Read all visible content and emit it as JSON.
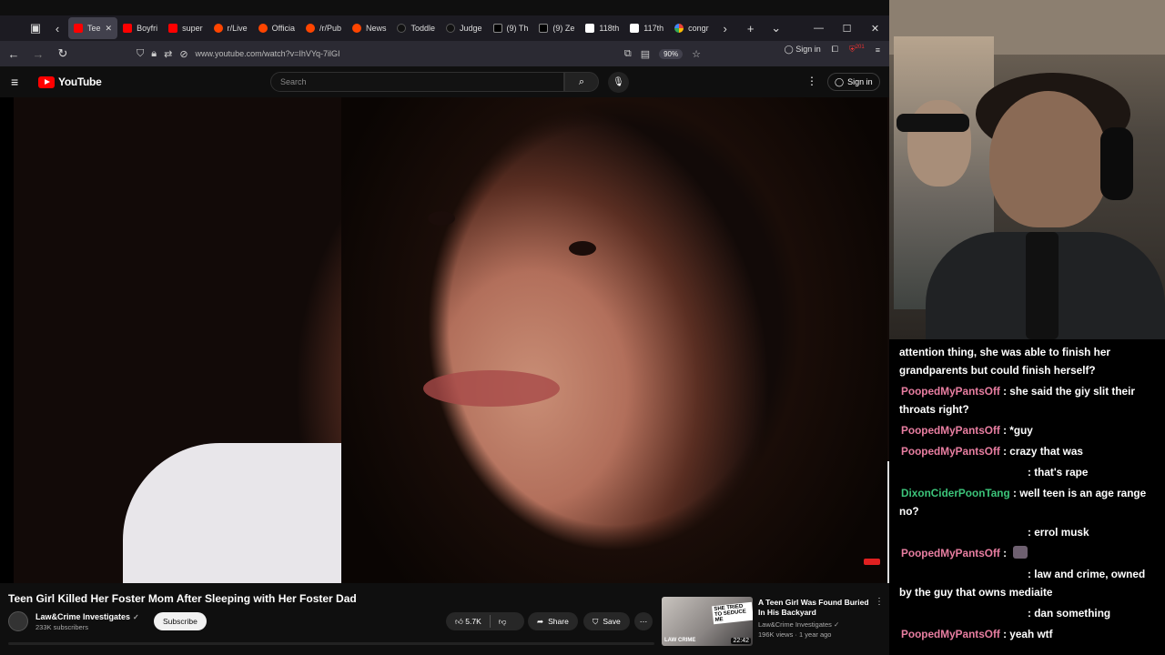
{
  "browser": {
    "tabs": [
      {
        "label": "Tee",
        "icon": "youtube-favicon",
        "active": true
      },
      {
        "label": "Boyfri",
        "icon": "youtube-favicon"
      },
      {
        "label": "super",
        "icon": "youtube-favicon"
      },
      {
        "label": "r/Live",
        "icon": "reddit-favicon"
      },
      {
        "label": "Officia",
        "icon": "reddit-favicon"
      },
      {
        "label": "/r/Pub",
        "icon": "reddit-favicon"
      },
      {
        "label": "News",
        "icon": "reddit-favicon"
      },
      {
        "label": "Toddle",
        "icon": "tiktok-favicon"
      },
      {
        "label": "Judge",
        "icon": "site-favicon"
      },
      {
        "label": "(9) Th",
        "icon": "x-favicon"
      },
      {
        "label": "(9) Ze",
        "icon": "x-favicon"
      },
      {
        "label": "118th",
        "icon": "wikipedia-favicon"
      },
      {
        "label": "117th",
        "icon": "wikipedia-favicon"
      },
      {
        "label": "congr",
        "icon": "google-favicon"
      }
    ],
    "url": "www.youtube.com/watch?v=IhVYq-7ilGI",
    "zoom": "90%",
    "signin_label": "Sign in",
    "notification_count": "201"
  },
  "youtube": {
    "logo_text": "YouTube",
    "search_placeholder": "Search",
    "signin_label": "Sign in",
    "video": {
      "title": "Teen Girl Killed Her Foster Mom After Sleeping with Her Foster Dad",
      "channel": "Law&Crime Investigates",
      "subscribers": "233K subscribers",
      "subscribe_label": "Subscribe",
      "likes": "5.7K",
      "share_label": "Share",
      "save_label": "Save"
    },
    "recommended": {
      "title": "A Teen Girl Was Found Buried In His Backyard",
      "channel": "Law&Crime Investigates",
      "meta": "196K views · 1 year ago",
      "duration": "22:42",
      "thumb_caption": "SHE TRIED TO SEDUCE ME",
      "thumb_logo": "LAW CRIME"
    }
  },
  "chat": {
    "colors": {
      "pink": "#e87ea1",
      "green": "#3cc47a"
    },
    "messages": [
      {
        "user": "",
        "text": "attention thing, she was able to finish her grandparents but could finish herself?"
      },
      {
        "user": "PoopedMyPantsOff",
        "color": "pink",
        "text": "she said the giy slit their throats right?"
      },
      {
        "user": "PoopedMyPantsOff",
        "color": "pink",
        "text": "*guy"
      },
      {
        "user": "PoopedMyPantsOff",
        "color": "pink",
        "text": "crazy that was"
      },
      {
        "user": "",
        "text": "that's rape"
      },
      {
        "user": "DixonCiderPoonTang",
        "color": "green",
        "text": "well teen is an age range no?"
      },
      {
        "user": "",
        "text": "errol musk"
      },
      {
        "user": "PoopedMyPantsOff",
        "color": "pink",
        "text": "",
        "emote": true
      },
      {
        "user": "",
        "text": "law and crime, owned by the guy that owns mediaite"
      },
      {
        "user": "",
        "text": "dan something"
      },
      {
        "user": "PoopedMyPantsOff",
        "color": "pink",
        "text": "yeah wtf"
      }
    ]
  }
}
